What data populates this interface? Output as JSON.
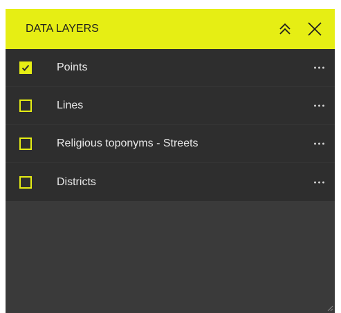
{
  "panel": {
    "title": "DATA LAYERS",
    "collapse_icon": "double-chevron-up-icon",
    "close_icon": "close-icon"
  },
  "layers": [
    {
      "label": "Points",
      "checked": true
    },
    {
      "label": "Lines",
      "checked": false
    },
    {
      "label": "Religious toponyms - Streets",
      "checked": false
    },
    {
      "label": "Districts",
      "checked": false
    }
  ],
  "colors": {
    "accent": "#e6ee14",
    "panel_bg": "#3a3a3a",
    "list_bg": "#2e2e2e",
    "text": "#e8e8e8"
  }
}
